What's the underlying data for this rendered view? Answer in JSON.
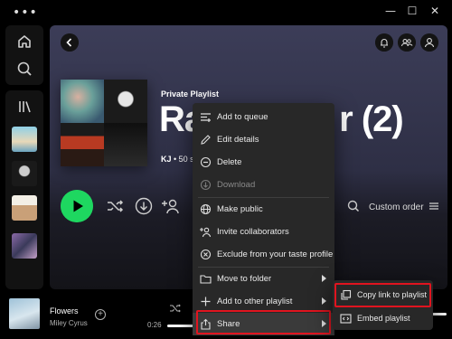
{
  "window": {
    "menu_glyph": "•••",
    "minimize_glyph": "—",
    "maximize_glyph": "☐",
    "close_glyph": "✕"
  },
  "rail": {
    "icons": [
      "home-icon",
      "search-icon",
      "library-icon"
    ]
  },
  "playlist": {
    "type_label": "Private Playlist",
    "title": "Ra",
    "title_tail": "r (2)",
    "owner": "KJ",
    "meta_suffix": " • 50 s",
    "sort_label": "Custom order"
  },
  "context_menu": {
    "items": [
      {
        "label": "Add to queue",
        "icon": "queue-icon"
      },
      {
        "label": "Edit details",
        "icon": "pencil-icon"
      },
      {
        "label": "Delete",
        "icon": "minus-circle-icon"
      },
      {
        "label": "Download",
        "icon": "download-icon",
        "disabled": true
      },
      {
        "label": "Make public",
        "icon": "globe-icon"
      },
      {
        "label": "Invite collaborators",
        "icon": "user-add-icon"
      },
      {
        "label": "Exclude from your taste profile",
        "icon": "block-icon"
      },
      {
        "label": "Move to folder",
        "icon": "folder-icon"
      },
      {
        "label": "Add to other playlist",
        "icon": "plus-icon"
      },
      {
        "label": "Share",
        "icon": "share-icon"
      }
    ]
  },
  "share_submenu": {
    "items": [
      {
        "label": "Copy link to playlist",
        "icon": "copy-icon"
      },
      {
        "label": "Embed playlist",
        "icon": "embed-icon"
      }
    ]
  },
  "now_playing": {
    "title": "Flowers",
    "artist": "Miley Cyrus",
    "elapsed": "0:26"
  },
  "colors": {
    "accent": "#1ed760",
    "highlight": "#e0141f",
    "menu_bg": "#282828"
  }
}
